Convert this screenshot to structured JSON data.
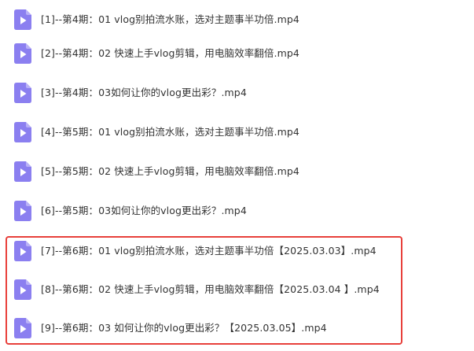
{
  "files": [
    {
      "name": "[1]--第4期：01 vlog别拍流水账，选对主题事半功倍.mp4",
      "icon": "video-file-icon"
    },
    {
      "name": "[2]--第4期：02 快速上手vlog剪辑，用电脑效率翻倍.mp4",
      "icon": "video-file-icon"
    },
    {
      "name": "[3]--第4期：03如何让你的vlog更出彩？.mp4",
      "icon": "video-file-icon"
    },
    {
      "name": "[4]--第5期：01 vlog别拍流水账，选对主题事半功倍.mp4",
      "icon": "video-file-icon"
    },
    {
      "name": "[5]--第5期：02 快速上手vlog剪辑，用电脑效率翻倍.mp4",
      "icon": "video-file-icon"
    },
    {
      "name": "[6]--第5期：03如何让你的vlog更出彩？.mp4",
      "icon": "video-file-icon"
    },
    {
      "name": "[7]--第6期：01 vlog别拍流水账，选对主题事半功倍【2025.03.03】.mp4",
      "icon": "video-file-icon"
    },
    {
      "name": "[8]--第6期：02 快速上手vlog剪辑，用电脑效率翻倍【2025.03.04 】.mp4",
      "icon": "video-file-icon"
    },
    {
      "name": "[9]--第6期：03 如何让你的vlog更出彩？【2025.03.05】.mp4",
      "icon": "video-file-icon"
    }
  ],
  "colors": {
    "icon_fill": "#8b7ff0",
    "icon_fold": "#b9b1f7",
    "text": "#333333",
    "highlight": "#e8403b"
  }
}
